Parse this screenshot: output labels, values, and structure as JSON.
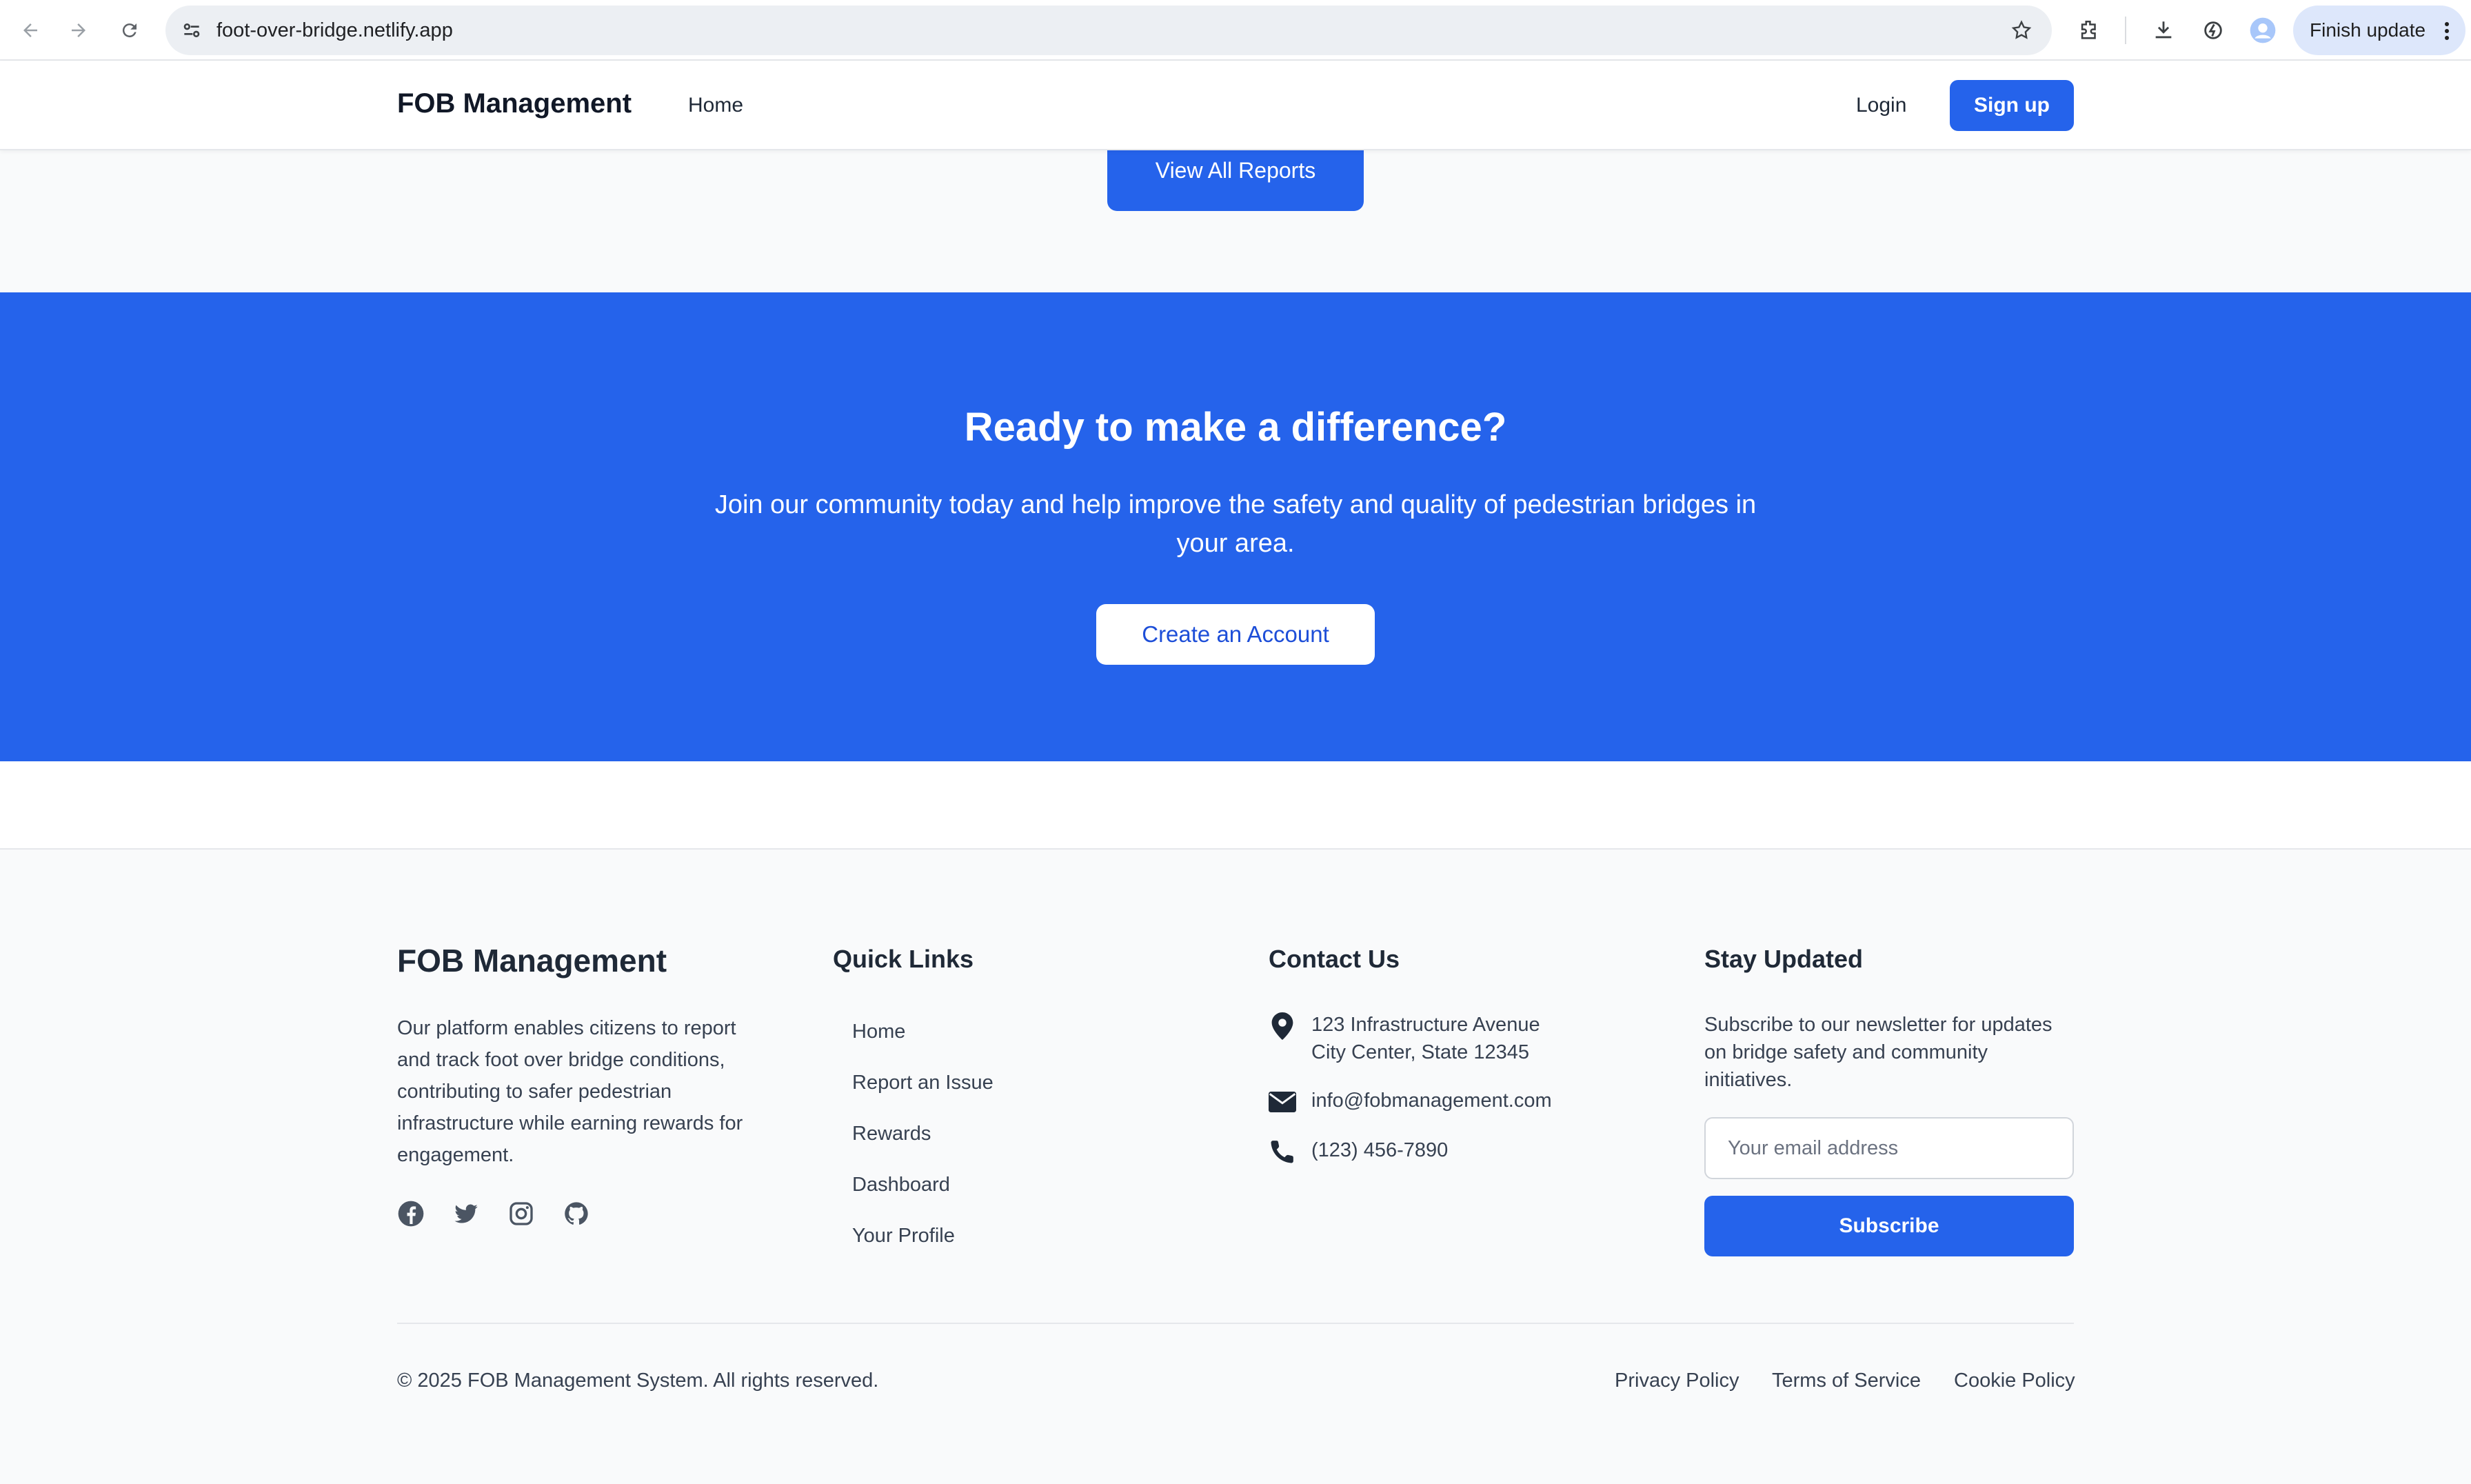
{
  "browser": {
    "url": "foot-over-bridge.netlify.app",
    "finish_update": "Finish update"
  },
  "nav": {
    "brand": "FOB Management",
    "home": "Home",
    "login": "Login",
    "signup": "Sign up"
  },
  "reports": {
    "view_all": "View All Reports"
  },
  "cta": {
    "title": "Ready to make a difference?",
    "text": "Join our community today and help improve the safety and quality of pedestrian bridges in your area.",
    "button": "Create an Account"
  },
  "footer": {
    "brand": "FOB Management",
    "description": "Our platform enables citizens to report and track foot over bridge conditions, contributing to safer pedestrian infrastructure while earning rewards for engagement.",
    "socials": [
      "facebook-icon",
      "twitter-icon",
      "instagram-icon",
      "github-icon"
    ],
    "quick_links_title": "Quick Links",
    "quick_links": [
      "Home",
      "Report an Issue",
      "Rewards",
      "Dashboard",
      "Your Profile"
    ],
    "contact_title": "Contact Us",
    "address_line1": "123 Infrastructure Avenue",
    "address_line2": "City Center, State 12345",
    "email": "info@fobmanagement.com",
    "phone": "(123) 456-7890",
    "newsletter_title": "Stay Updated",
    "newsletter_text": "Subscribe to our newsletter for updates on bridge safety and community initiatives.",
    "email_placeholder": "Your email address",
    "subscribe": "Subscribe",
    "copyright": "© 2025 FOB Management System. All rights reserved.",
    "privacy": "Privacy Policy",
    "terms": "Terms of Service",
    "cookie": "Cookie Policy"
  },
  "colors": {
    "primary": "#2563eb",
    "footer_bg": "#f9fafb",
    "text_dark": "#1f2937"
  }
}
